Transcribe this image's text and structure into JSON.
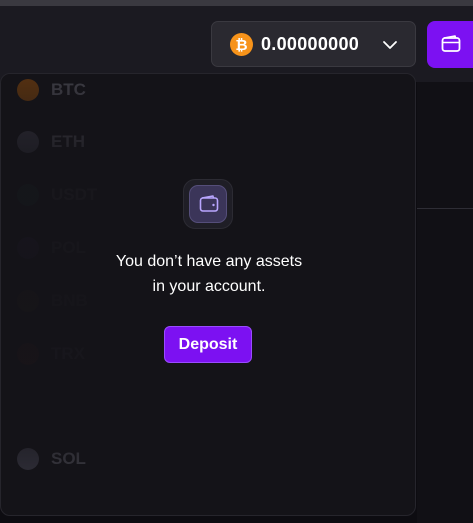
{
  "header": {
    "balance": {
      "currency_icon": "bitcoin-icon",
      "amount": "0.00000000",
      "chevron_icon": "chevron-down-icon"
    },
    "wallet_button_icon": "wallet-icon"
  },
  "assets_dropdown": {
    "assets": [
      {
        "symbol": "BTC",
        "icon": "bitcoin-icon",
        "color": "#6b3b0f"
      },
      {
        "symbol": "ETH",
        "icon": "ethereum-icon",
        "color": "#3a3945"
      },
      {
        "symbol": "USDT",
        "icon": "tether-icon",
        "color": "#1c3a35"
      },
      {
        "symbol": "POL",
        "icon": "polygon-icon",
        "color": "#2f2552"
      },
      {
        "symbol": "BNB",
        "icon": "bnb-icon",
        "color": "#4a3a10"
      },
      {
        "symbol": "TRX",
        "icon": "tron-icon",
        "color": "#4a1a1f"
      },
      {
        "symbol": "SOL",
        "icon": "solana-icon",
        "color": "#3a3945"
      }
    ],
    "empty_state": {
      "icon": "wallet-icon",
      "message_line1": "You don’t have any assets",
      "message_line2": "in your account.",
      "deposit_label": "Deposit"
    }
  },
  "colors": {
    "accent": "#7c11f2",
    "background": "#0d0c11",
    "panel": "#141318",
    "bitcoin": "#f7931a"
  }
}
